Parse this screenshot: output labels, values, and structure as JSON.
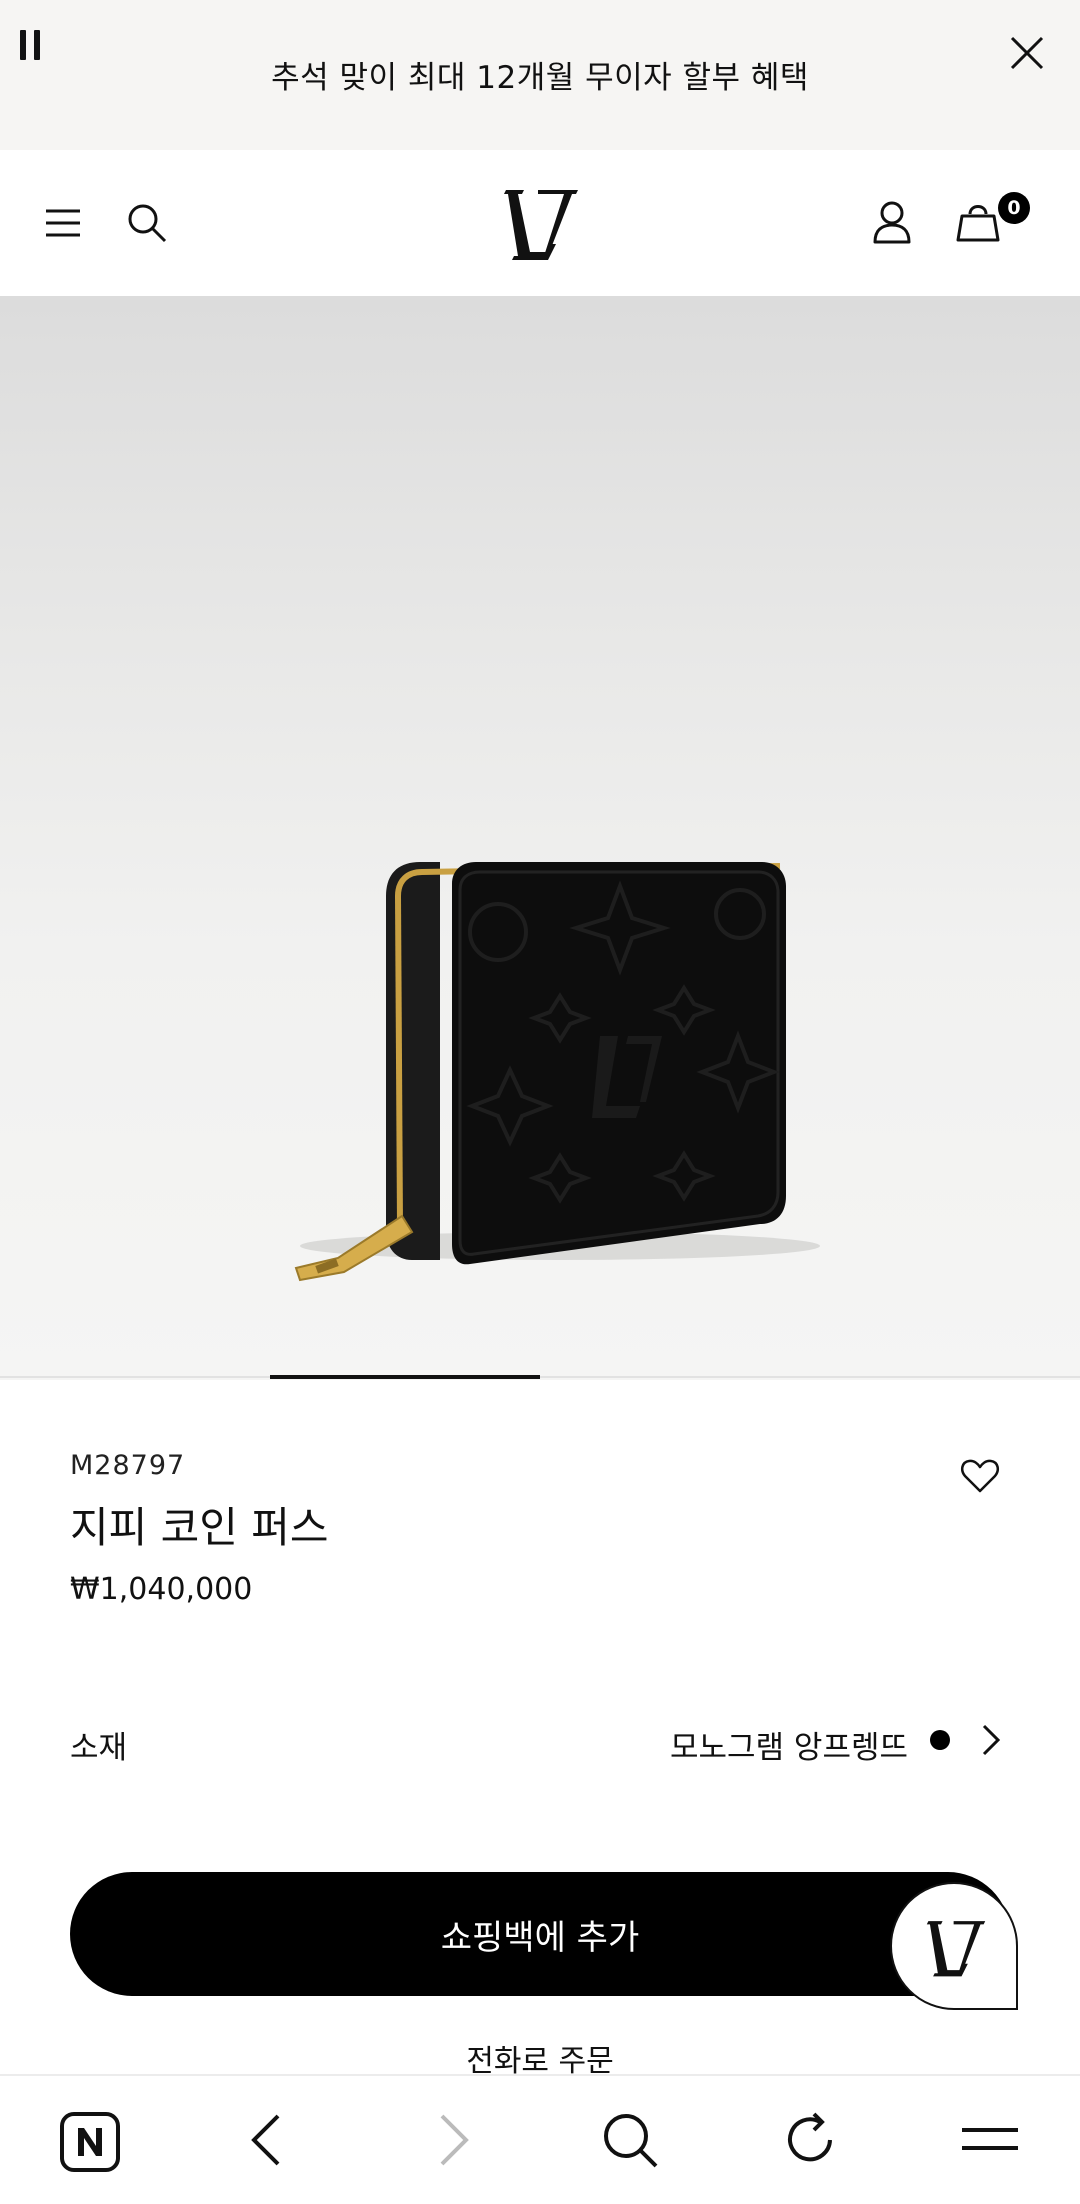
{
  "announcement": {
    "text": "추석 맞이 최대 12개월 무이자 할부 혜택"
  },
  "header": {
    "logo_text": "LV",
    "bag_count": "0"
  },
  "gallery": {
    "active_index": 2,
    "total": 4
  },
  "product": {
    "sku": "M28797",
    "name": "지피 코인 퍼스",
    "price": "₩1,040,000",
    "material_label": "소재",
    "material_value": "모노그램 앙프렝뜨",
    "swatch_color": "#000000"
  },
  "actions": {
    "add_to_bag": "쇼핑백에 추가",
    "order_by_phone": "전화로 주문"
  },
  "colors": {
    "primary": "#000000",
    "announcement_bg": "#f6f5f3"
  }
}
